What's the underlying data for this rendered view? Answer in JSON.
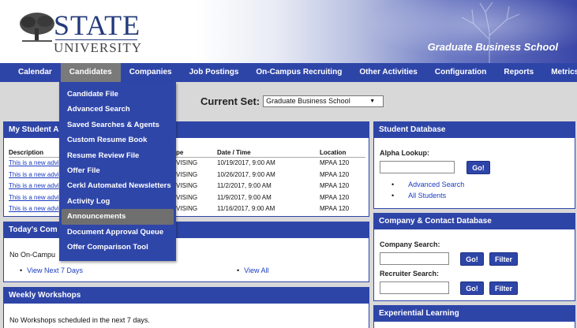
{
  "header": {
    "logo_state": "STATE",
    "logo_university": "UNIVERSITY",
    "school_name": "Graduate Business School"
  },
  "nav": {
    "items": [
      "Calendar",
      "Candidates",
      "Companies",
      "Job Postings",
      "On-Campus Recruiting",
      "Other Activities",
      "Configuration",
      "Reports",
      "Metrics"
    ],
    "active": "Candidates"
  },
  "current_set": {
    "label": "Current Set:",
    "value": "Graduate Business School"
  },
  "dropdown": {
    "items": [
      "Candidate File",
      "Advanced Search",
      "Saved Searches & Agents",
      "Custom Resume Book",
      "Resume Review File",
      "Offer File",
      "Cerkl Automated Newsletters",
      "Activity Log",
      "Announcements",
      "Document Approval Queue",
      "Offer Comparison Tool"
    ],
    "active": "Announcements"
  },
  "advising": {
    "title": "My Student A",
    "columns": [
      "Description",
      "pe",
      "Date / Time",
      "Location"
    ],
    "rows": [
      [
        "This is a new advi",
        "VISING",
        "10/19/2017, 9:00 AM",
        "MPAA 120"
      ],
      [
        "This is a new advi",
        "VISING",
        "10/26/2017, 9:00 AM",
        "MPAA 120"
      ],
      [
        "This is a new advi",
        "VISING",
        "11/2/2017, 9:00 AM",
        "MPAA 120"
      ],
      [
        "This is a new advi",
        "VISING",
        "11/9/2017, 9:00 AM",
        "MPAA 120"
      ],
      [
        "This is a new advi",
        "VISING",
        "11/16/2017, 9:00 AM",
        "MPAA 120"
      ]
    ]
  },
  "today": {
    "title": "Today's Com",
    "message": "No On-Campu",
    "link_next": "View Next 7 Days",
    "link_all": "View All"
  },
  "workshops": {
    "title": "Weekly Workshops",
    "message": "No Workshops scheduled in the next 7 days."
  },
  "student_db": {
    "title": "Student Database",
    "alpha_label": "Alpha Lookup:",
    "go": "Go!",
    "link_advanced": "Advanced Search",
    "link_all": "All Students"
  },
  "company_db": {
    "title": "Company & Contact Database",
    "company_label": "Company Search:",
    "recruiter_label": "Recruiter Search:",
    "go": "Go!",
    "filter": "Filter"
  },
  "experiential": {
    "title": "Experiential Learning"
  }
}
